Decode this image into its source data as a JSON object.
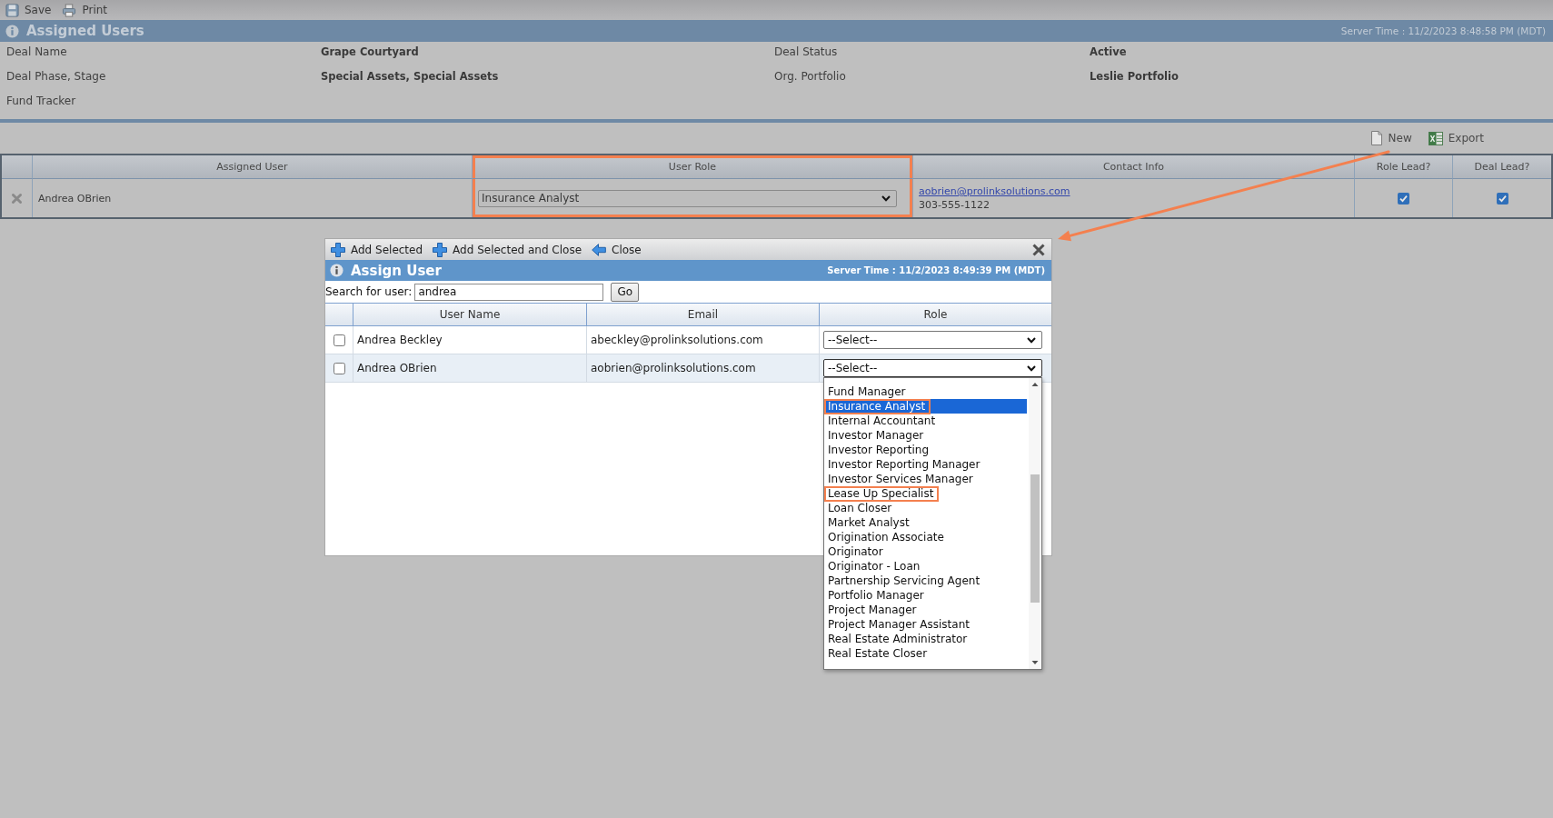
{
  "toolbar": [
    {
      "kind": "save",
      "label": "Save"
    },
    {
      "kind": "print",
      "label": "Print"
    }
  ],
  "header": {
    "title": "Assigned Users",
    "server_time": "Server Time : 11/2/2023 8:48:58 PM (MDT)"
  },
  "deal_info": [
    {
      "label": "Deal Name",
      "value": "Grape Courtyard"
    },
    {
      "label": "Deal Status",
      "value": "Active"
    },
    {
      "label": "Deal Phase, Stage",
      "value": "Special Assets, Special Assets"
    },
    {
      "label": "Org. Portfolio",
      "value": "Leslie Portfolio"
    },
    {
      "label": "Fund Tracker"
    }
  ],
  "grid_actions": [
    {
      "kind": "new",
      "label": "New"
    },
    {
      "kind": "export",
      "label": "Export"
    }
  ],
  "assigned_users": {
    "columns": [
      {
        "label": "Assigned User",
        "outlined": false
      },
      {
        "label": "User Role",
        "outlined": true
      },
      {
        "label": "Contact Info",
        "outlined": false
      },
      {
        "label": "Role Lead?",
        "outlined": false
      },
      {
        "label": "Deal Lead?",
        "outlined": false
      }
    ],
    "rows": [
      {
        "user": "Andrea OBrien",
        "role": "Insurance Analyst",
        "email": "aobrien@prolinksolutions.com",
        "phone": "303-555-1122",
        "role_lead": true,
        "deal_lead": true
      }
    ]
  },
  "dialog": {
    "toolbar": [
      {
        "kind": "add",
        "label": "Add Selected"
      },
      {
        "kind": "add",
        "label": "Add Selected and Close"
      },
      {
        "kind": "back",
        "label": "Close"
      }
    ],
    "title": "Assign User",
    "server_time": "Server Time : 11/2/2023 8:49:39 PM (MDT)",
    "search": {
      "label": "Search for user:",
      "value": "andrea",
      "button": "Go"
    },
    "columns": [
      "User Name",
      "Email",
      "Role"
    ],
    "rows": [
      {
        "name": "Andrea Beckley",
        "email": "abeckley@prolinksolutions.com",
        "role": "--Select--",
        "checked": false,
        "open": false
      },
      {
        "name": "Andrea OBrien",
        "email": "aobrien@prolinksolutions.com",
        "role": "--Select--",
        "checked": false,
        "open": true
      }
    ],
    "role_options": [
      {
        "label": "Fund Manager",
        "selected": false,
        "outlined": false
      },
      {
        "label": "Insurance Analyst",
        "selected": true,
        "outlined": true
      },
      {
        "label": "Internal Accountant",
        "selected": false,
        "outlined": false
      },
      {
        "label": "Investor Manager",
        "selected": false,
        "outlined": false
      },
      {
        "label": "Investor Reporting",
        "selected": false,
        "outlined": false
      },
      {
        "label": "Investor Reporting Manager",
        "selected": false,
        "outlined": false
      },
      {
        "label": "Investor Services Manager",
        "selected": false,
        "outlined": false
      },
      {
        "label": "Lease Up Specialist",
        "selected": false,
        "outlined": true
      },
      {
        "label": "Loan Closer",
        "selected": false,
        "outlined": false
      },
      {
        "label": "Market Analyst",
        "selected": false,
        "outlined": false
      },
      {
        "label": "Origination Associate",
        "selected": false,
        "outlined": false
      },
      {
        "label": "Originator",
        "selected": false,
        "outlined": false
      },
      {
        "label": "Originator - Loan",
        "selected": false,
        "outlined": false
      },
      {
        "label": "Partnership Servicing Agent",
        "selected": false,
        "outlined": false
      },
      {
        "label": "Portfolio Manager",
        "selected": false,
        "outlined": false
      },
      {
        "label": "Project Manager",
        "selected": false,
        "outlined": false
      },
      {
        "label": "Project Manager Assistant",
        "selected": false,
        "outlined": false
      },
      {
        "label": "Real Estate Administrator",
        "selected": false,
        "outlined": false
      },
      {
        "label": "Real Estate Closer",
        "selected": false,
        "outlined": false
      }
    ]
  }
}
